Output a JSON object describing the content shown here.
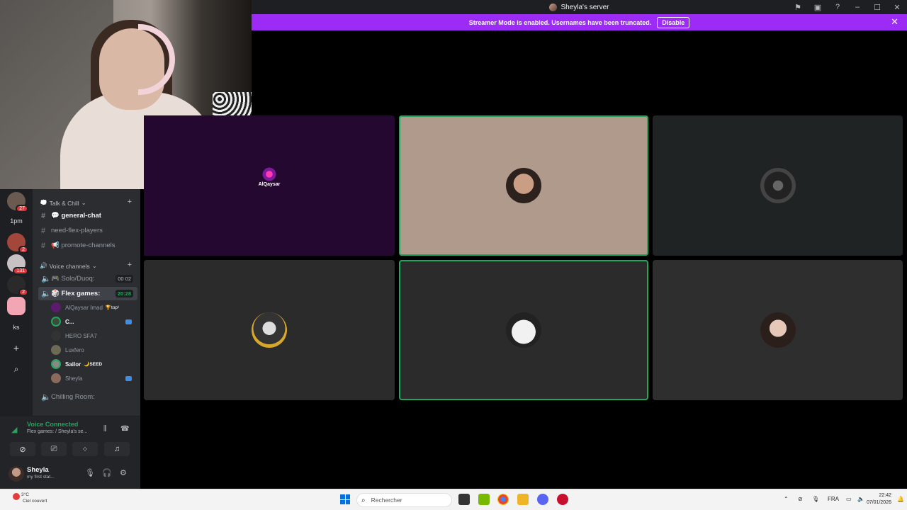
{
  "window": {
    "title": "Sheyla's server",
    "icons": [
      "flag-icon",
      "inbox-icon",
      "help-icon",
      "minimize-icon",
      "maximize-icon",
      "close-icon"
    ]
  },
  "banner": {
    "text": "Streamer Mode is enabled. Usernames have been truncated.",
    "button": "Disable",
    "close": "✕"
  },
  "guilds": [
    {
      "label": "",
      "badge": "27"
    },
    {
      "label": "1pm",
      "badge": ""
    },
    {
      "label": "",
      "badge": "2"
    },
    {
      "label": "",
      "badge": "131"
    },
    {
      "label": "",
      "badge": "2"
    },
    {
      "label": "",
      "badge": ""
    },
    {
      "label": "ks",
      "badge": ""
    },
    {
      "label": "+",
      "badge": ""
    },
    {
      "label": "⌕",
      "badge": ""
    }
  ],
  "categories": {
    "talk": "Talk & Chill",
    "voice": "Voice channels"
  },
  "text_channels": [
    {
      "name": "💬 general-chat"
    },
    {
      "name": "need-flex-players"
    },
    {
      "name": "📢 promote-channels"
    }
  ],
  "voice_channels": {
    "solo": {
      "name": "🎮 Solo/Duoq:",
      "tag": "00 02"
    },
    "flex": {
      "name": "🎲 Flex games:",
      "tag": "20:28"
    },
    "chilling": {
      "name": "Chilling Room:"
    }
  },
  "voice_users": [
    {
      "name": "AlQaysar Imad",
      "tag": "🏆top¹"
    },
    {
      "name": "C...",
      "tag": ""
    },
    {
      "name": "HERO SFA7",
      "tag": ""
    },
    {
      "name": "Luxfero",
      "tag": ""
    },
    {
      "name": "Sailor",
      "tag": "🌙SEED"
    },
    {
      "name": "Sheyla",
      "tag": ""
    }
  ],
  "voice_panel": {
    "status": "Voice Connected",
    "subtitle": "Flex games: / Sheyla's se...",
    "user": "Sheyla",
    "user_status": "my first stat..."
  },
  "tiles": [
    {
      "label": "AlQaysar",
      "bg": "#25082f",
      "speaking": false
    },
    {
      "label": "",
      "bg": "#b09a8c",
      "speaking": true
    },
    {
      "label": "",
      "bg": "#1f2323",
      "speaking": false
    },
    {
      "label": "",
      "bg": "#2b2b2b",
      "speaking": false
    },
    {
      "label": "",
      "bg": "#2b2b2b",
      "speaking": true
    },
    {
      "label": "",
      "bg": "#2e2e2e",
      "speaking": false
    }
  ],
  "taskbar": {
    "weather_temp": "3°C",
    "weather_desc": "Ciel couvert",
    "search_placeholder": "Rechercher",
    "language": "FRA",
    "time": "22:42",
    "date": "07/01/2026"
  }
}
